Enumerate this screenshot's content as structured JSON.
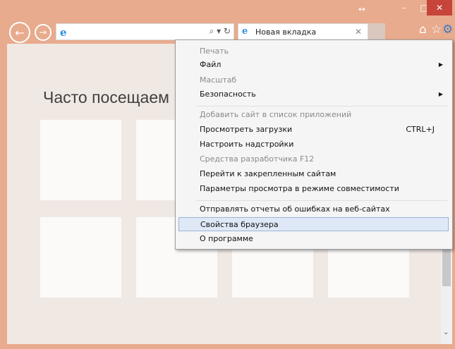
{
  "window_controls": {
    "restore_glyph": "↔",
    "minimize": "–",
    "maximize": "□",
    "close": "✕"
  },
  "address": {
    "tools": "⌕ ▾ ↻"
  },
  "tab": {
    "title": "Новая вкладка",
    "close": "✕"
  },
  "toolbar_icons": {
    "home": "⌂",
    "favorites": "☆",
    "settings": "⚙"
  },
  "content": {
    "heading": "Часто посещаем"
  },
  "menu": {
    "items": [
      {
        "label": "Печать",
        "disabled": true
      },
      {
        "label": "Файл",
        "submenu": true
      },
      {
        "label": "Масштаб",
        "disabled": true
      },
      {
        "label": "Безопасность",
        "submenu": true
      },
      {
        "label": "Добавить сайт в список приложений",
        "disabled": true
      },
      {
        "label": "Просмотреть загрузки",
        "shortcut": "CTRL+J"
      },
      {
        "label": "Настроить надстройки"
      },
      {
        "label": "Средства разработчика F12",
        "disabled": true
      },
      {
        "label": "Перейти к закрепленным сайтам"
      },
      {
        "label": "Параметры просмотра в режиме совместимости"
      },
      {
        "label": "Отправлять отчеты об ошибках на веб-сайтах"
      },
      {
        "label": "Свойства браузера",
        "selected": true
      },
      {
        "label": "О программе"
      }
    ]
  },
  "colors": {
    "frame": "#e8ab8d",
    "close_button": "#c7443a",
    "selected": "#dfe8f6"
  }
}
